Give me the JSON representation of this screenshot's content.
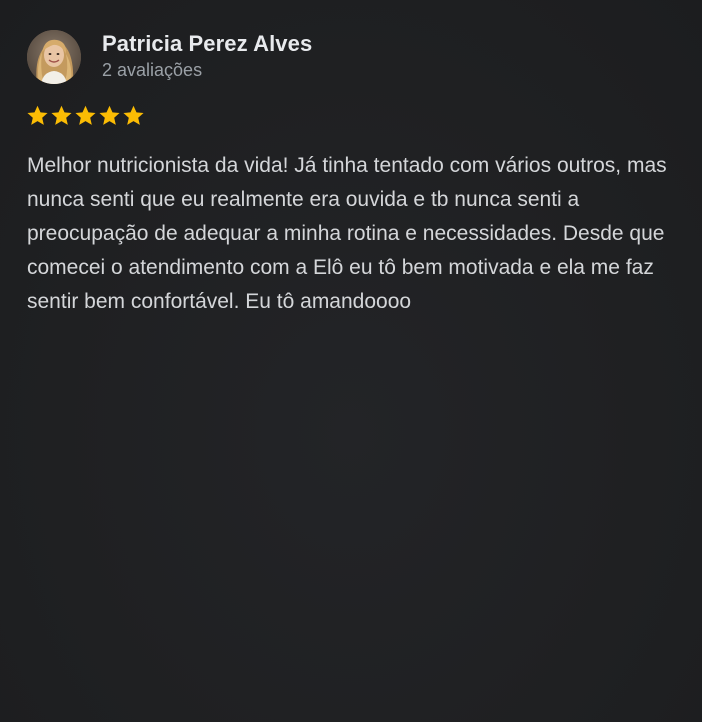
{
  "review": {
    "author": "Patricia Perez Alves",
    "meta": "2 avaliações",
    "rating": 5,
    "rating_max": 5,
    "star_color": "#fbbc04",
    "text": "Melhor nutricionista da vida! Já tinha tentado com vários outros, mas nunca senti que eu realmente era ouvida e tb nunca senti a preocupação de adequar a minha rotina e necessidades. Desde que comecei o atendimento com a Elô eu tô bem motivada e ela me faz sentir bem confortável. Eu tô amandoooo"
  },
  "colors": {
    "background": "#202124",
    "name": "#e8eaed",
    "meta": "#9aa0a6",
    "body_text": "#d4d6d9"
  }
}
